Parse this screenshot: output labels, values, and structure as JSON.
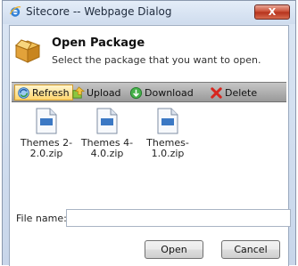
{
  "window": {
    "title": "Sitecore -- Webpage Dialog",
    "close_label": "X"
  },
  "header": {
    "title": "Open Package",
    "subtitle": "Select the package that you want to open."
  },
  "toolbar": {
    "refresh": "Refresh",
    "upload": "Upload",
    "download": "Download",
    "delete": "Delete"
  },
  "files": [
    {
      "line1": "Themes 2-",
      "line2": "2.0.zip"
    },
    {
      "line1": "Themes 4-",
      "line2": "4.0.zip"
    },
    {
      "line1": "Themes-",
      "line2": "1.0.zip"
    }
  ],
  "file_name": {
    "label": "File name:",
    "value": ""
  },
  "buttons": {
    "open": "Open",
    "cancel": "Cancel"
  },
  "icons": [
    "ie-icon",
    "package-icon",
    "refresh-icon",
    "upload-icon",
    "download-icon",
    "delete-icon",
    "zip-file-icon"
  ],
  "colors": {
    "toolbar": "#a9a9a9",
    "close": "#c94a31",
    "selected_tool": "#ffd56d"
  }
}
